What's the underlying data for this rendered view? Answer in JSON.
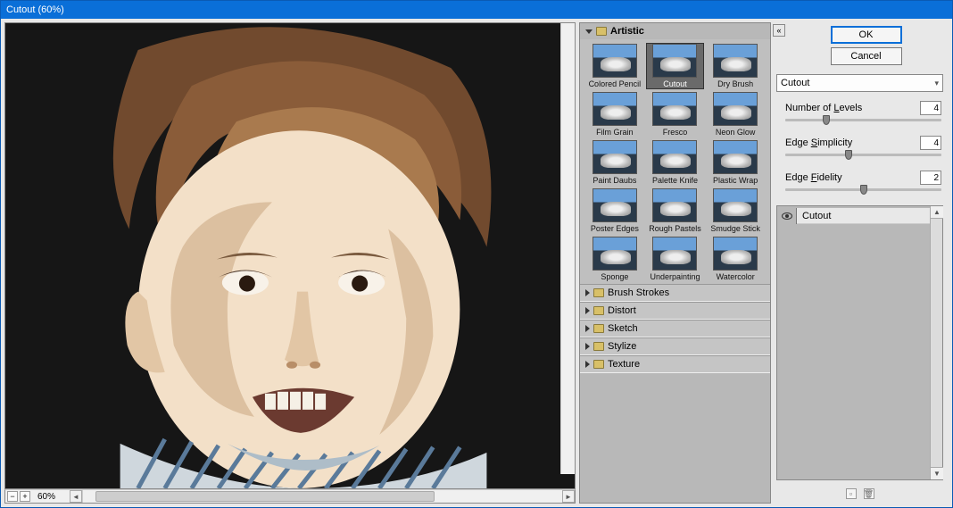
{
  "window": {
    "title": "Cutout (60%)"
  },
  "preview": {
    "zoom": "60%"
  },
  "gallery": {
    "expanded_category": "Artistic",
    "selected_thumb": "Cutout",
    "thumbs": [
      {
        "label": "Colored Pencil"
      },
      {
        "label": "Cutout"
      },
      {
        "label": "Dry Brush"
      },
      {
        "label": "Film Grain"
      },
      {
        "label": "Fresco"
      },
      {
        "label": "Neon Glow"
      },
      {
        "label": "Paint Daubs"
      },
      {
        "label": "Palette Knife"
      },
      {
        "label": "Plastic Wrap"
      },
      {
        "label": "Poster Edges"
      },
      {
        "label": "Rough Pastels"
      },
      {
        "label": "Smudge Stick"
      },
      {
        "label": "Sponge"
      },
      {
        "label": "Underpainting"
      },
      {
        "label": "Watercolor"
      }
    ],
    "collapsed_categories": [
      "Brush Strokes",
      "Distort",
      "Sketch",
      "Stylize",
      "Texture"
    ]
  },
  "buttons": {
    "ok": "OK",
    "cancel": "Cancel"
  },
  "filter_dropdown": "Cutout",
  "sliders": {
    "levels": {
      "label_pre": "Number of ",
      "u": "L",
      "label_post": "evels",
      "value": "4",
      "pos": 24
    },
    "simplicity": {
      "label_pre": "Edge ",
      "u": "S",
      "label_post": "implicity",
      "value": "4",
      "pos": 38
    },
    "fidelity": {
      "label_pre": "Edge ",
      "u": "F",
      "label_post": "idelity",
      "value": "2",
      "pos": 48
    }
  },
  "stack": {
    "current": "Cutout"
  }
}
